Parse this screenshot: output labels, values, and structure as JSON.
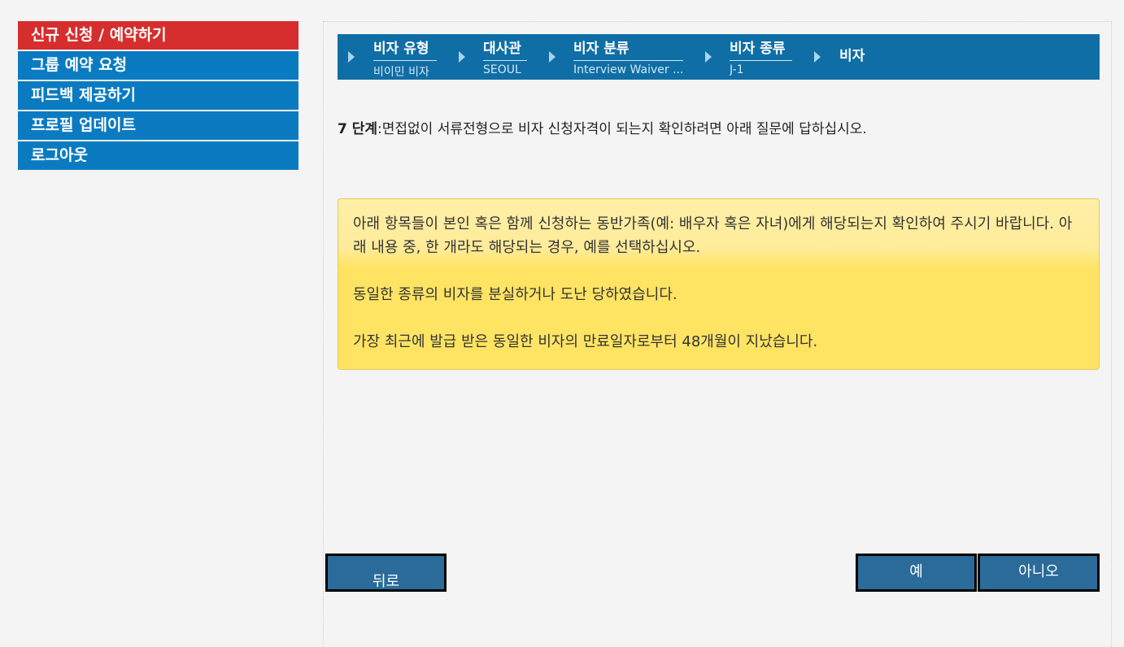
{
  "sidebar": {
    "items": [
      {
        "label": "신규 신청 / 예약하기",
        "active": true
      },
      {
        "label": "그룹 예약 요청",
        "active": false
      },
      {
        "label": "피드백 제공하기",
        "active": false
      },
      {
        "label": "프로필 업데이트",
        "active": false
      },
      {
        "label": "로그아웃",
        "active": false
      }
    ]
  },
  "breadcrumb": {
    "steps": [
      {
        "title": "비자 유형",
        "value": "비이민 비자"
      },
      {
        "title": "대사관",
        "value": "SEOUL"
      },
      {
        "title": "비자 분류",
        "value": "Interview Waiver ..."
      },
      {
        "title": "비자 종류",
        "value": "J-1"
      }
    ],
    "current": "비자",
    "arrow_icon": "triangle-right-icon"
  },
  "step": {
    "label": "7 단계",
    "text": ":면접없이 서류전형으로 비자 신청자격이 되는지 확인하려면 아래 질문에 답하십시오."
  },
  "notice": {
    "intro": "아래 항목들이 본인 혹은 함께 신청하는 동반가족(예: 배우자 혹은 자녀)에게 해당되는지 확인하여 주시기 바랍니다.  아래 내용 중, 한 개라도 해당되는 경우, 예를 선택하십시오.",
    "item1": "동일한 종류의 비자를 분실하거나 도난 당하였습니다.",
    "item2": "가장 최근에 발급 받은 동일한 비자의 만료일자로부터 48개월이 지났습니다."
  },
  "buttons": {
    "back": "뒤로",
    "yes": "예",
    "no": "아니오"
  },
  "colors": {
    "sidebar_active": "#d62e2e",
    "sidebar_item": "#0a7bc1",
    "breadcrumb_bg": "#0f6ea6",
    "notice_bg": "#ffe463",
    "button_bg": "#2a6b9a"
  }
}
